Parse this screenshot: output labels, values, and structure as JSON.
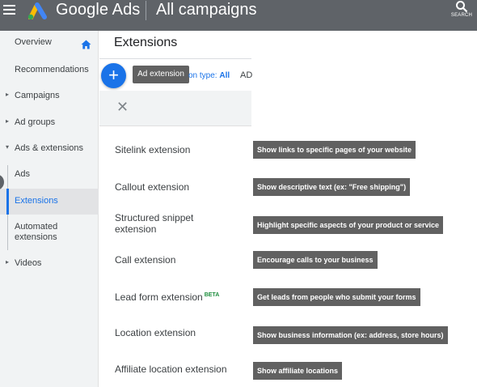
{
  "topbar": {
    "brand": "Google Ads",
    "page_title": "All campaigns",
    "search_label": "SEARCH"
  },
  "sidebar": {
    "items": [
      {
        "label": "Overview",
        "caret": "",
        "active": false
      },
      {
        "label": "Recommendations",
        "caret": "",
        "active": false
      },
      {
        "label": "Campaigns",
        "caret": "▸",
        "active": false
      },
      {
        "label": "Ad groups",
        "caret": "▸",
        "active": false
      },
      {
        "label": "Ads & extensions",
        "caret": "▾",
        "active": false
      },
      {
        "label": "Ads",
        "caret": "",
        "active": false
      },
      {
        "label": "Extensions",
        "caret": "",
        "active": true
      },
      {
        "label": "Automated extensions",
        "caret": "",
        "active": false
      },
      {
        "label": "Videos",
        "caret": "▸",
        "active": false
      }
    ]
  },
  "main": {
    "title": "Extensions",
    "fab_symbol": "+",
    "fab_tooltip": "Ad extension",
    "filter_prefix": "on type:",
    "filter_value": "All",
    "ad_chip": "AD",
    "close_symbol": "✕"
  },
  "extensions": [
    {
      "label": "Sitelink extension",
      "beta": "",
      "description": "Show links to specific pages of your website"
    },
    {
      "label": "Callout extension",
      "beta": "",
      "description": "Show descriptive text (ex: \"Free shipping\")"
    },
    {
      "label": "Structured snippet extension",
      "beta": "",
      "description": "Highlight specific aspects of your product or service"
    },
    {
      "label": "Call extension",
      "beta": "",
      "description": "Encourage calls to your business"
    },
    {
      "label": "Lead form extension",
      "beta": "BETA",
      "description": "Get leads from people who submit your forms"
    },
    {
      "label": "Location extension",
      "beta": "",
      "description": "Show business information (ex: address, store hours)"
    },
    {
      "label": "Affiliate location extension",
      "beta": "",
      "description": "Show affiliate locations"
    }
  ],
  "colors": {
    "topbar": "#5f6368",
    "accent": "#1a73e8",
    "tooltip": "#616161",
    "beta": "#1e8e3e"
  }
}
